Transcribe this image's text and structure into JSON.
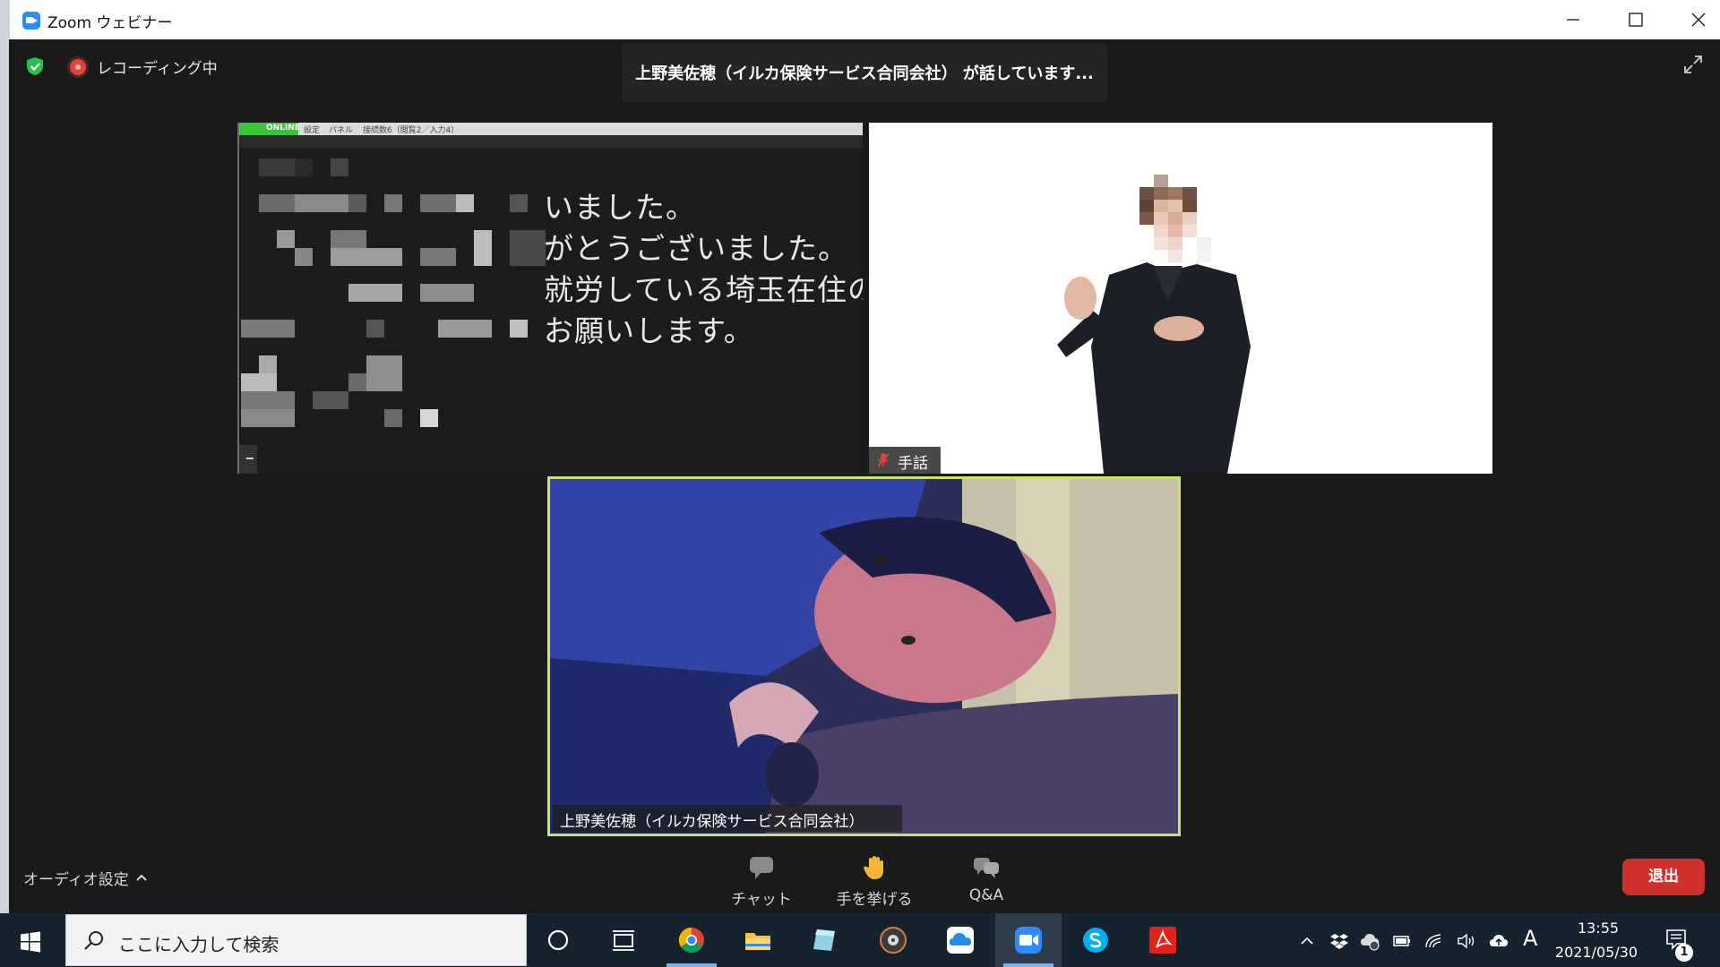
{
  "window": {
    "title": "Zoom ウェビナー"
  },
  "meeting": {
    "recording_text": "レコーディング中",
    "speaker_banner": "上野美佐穂（イルカ保険サービス合同会社） が話しています..."
  },
  "caption_tile": {
    "toolbar_status": "ONLINE",
    "toolbar_items": [
      "設定",
      "パネル",
      "接続数6（閲覧2／入力4）"
    ],
    "lines": [
      "いました。",
      "がとうございました。",
      "就労している埼玉在住の",
      "お願いします。"
    ]
  },
  "sign_tile": {
    "label": "手話"
  },
  "main_tile": {
    "name": "上野美佐穂（イルカ保険サービス合同会社）"
  },
  "toolbar": {
    "audio_settings": "オーディオ設定",
    "chat": "チャット",
    "raise_hand": "手を挙げる",
    "qa": "Q&A",
    "leave": "退出"
  },
  "taskbar": {
    "search_placeholder": "ここに入力して検索",
    "ime": "A",
    "time": "13:55",
    "date": "2021/05/30",
    "notification_count": "1"
  },
  "colors": {
    "accent": "#2d8cff",
    "leave": "#d0312d",
    "active_speaker_border": "#c8e46a",
    "recording": "#e0443c"
  }
}
